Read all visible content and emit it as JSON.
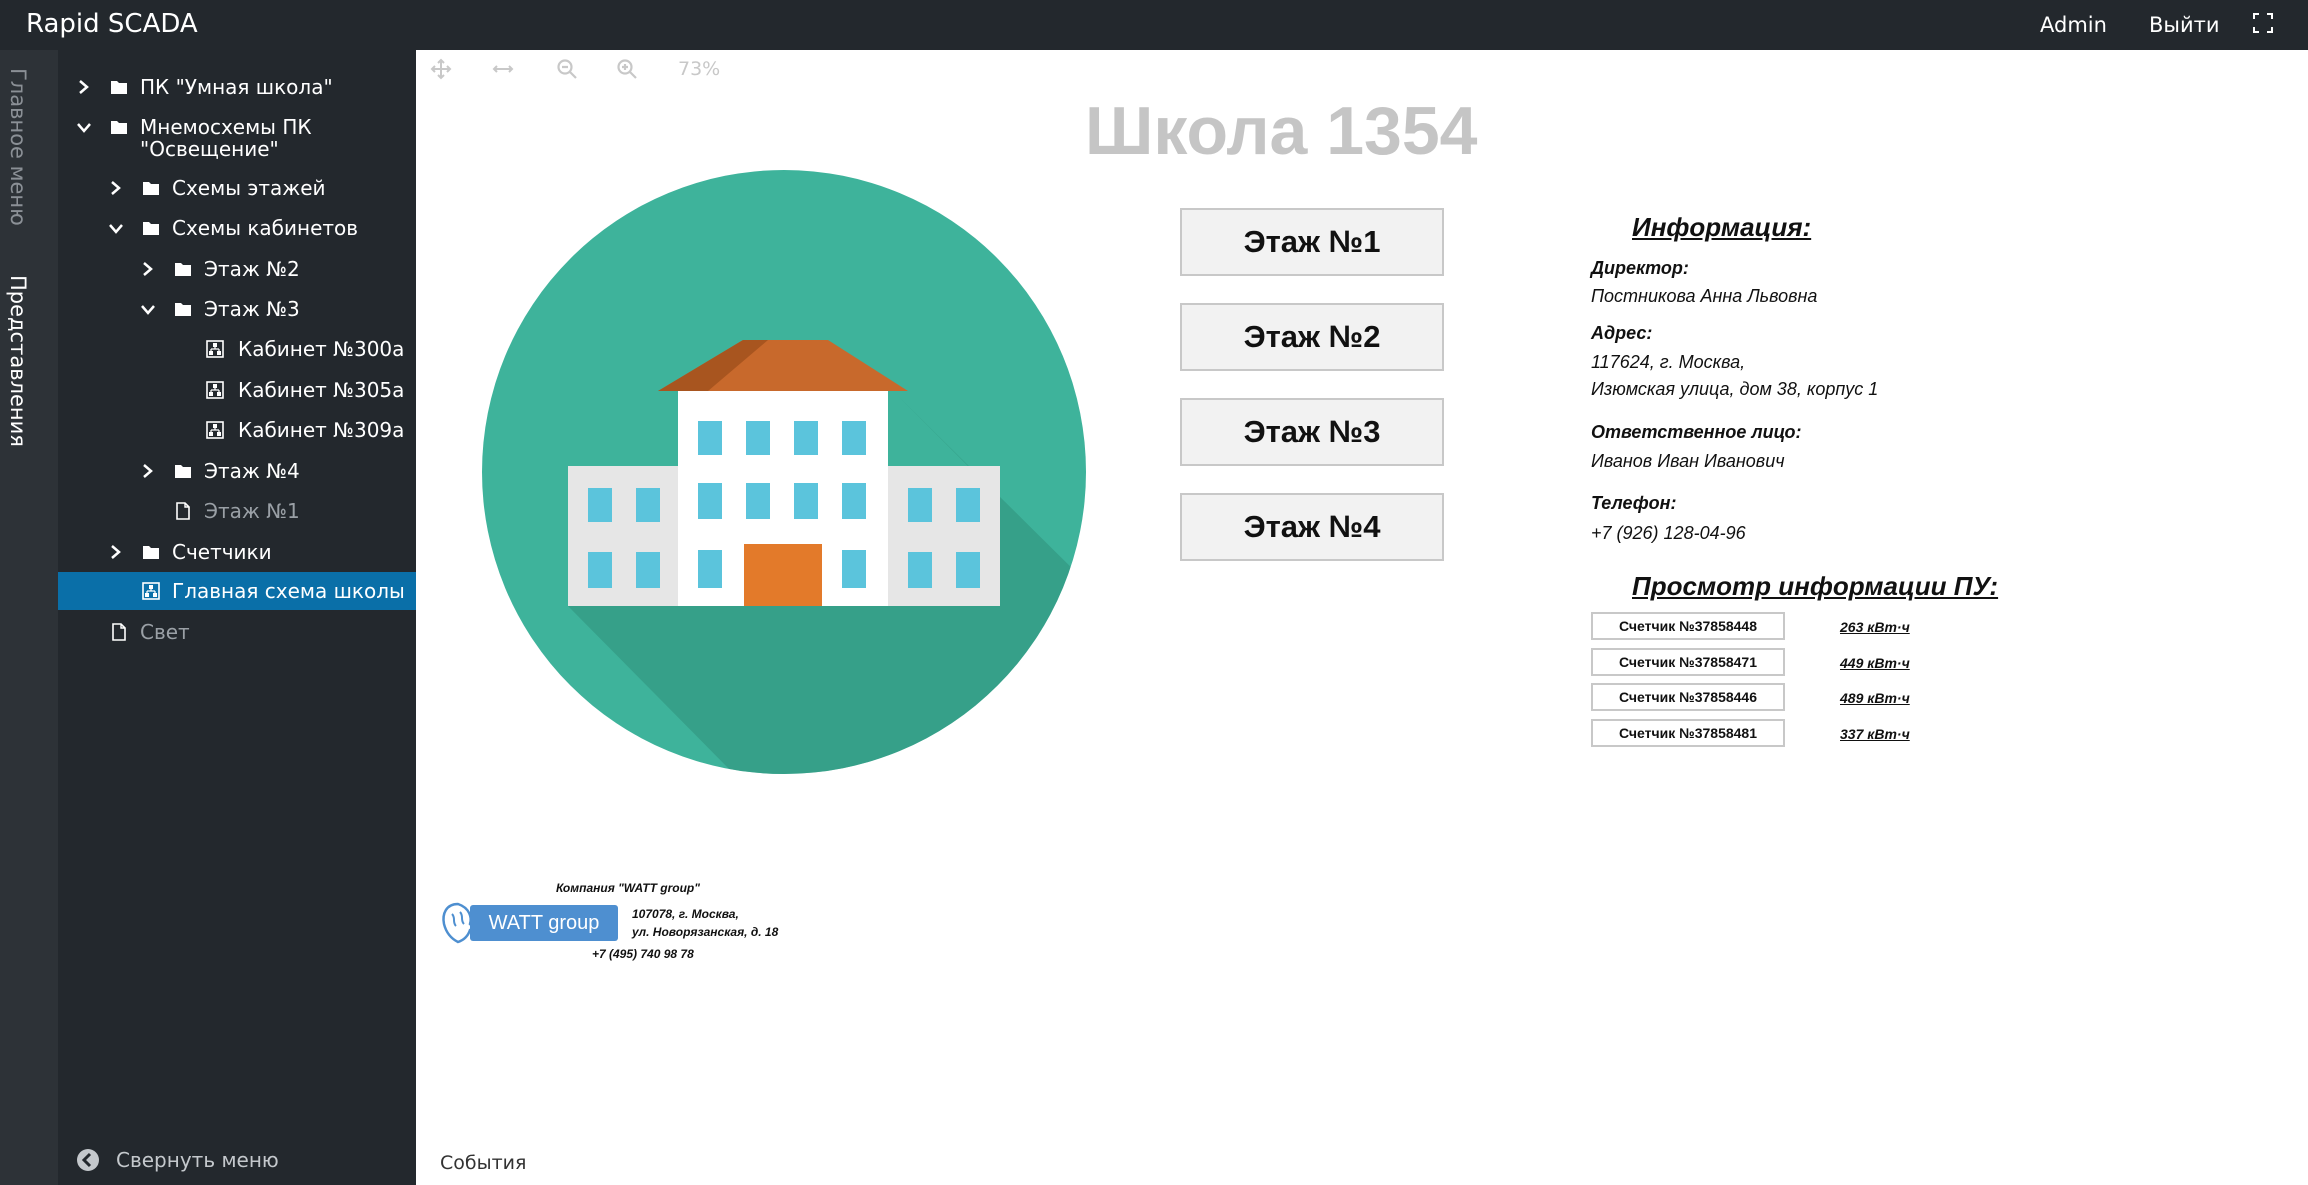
{
  "header": {
    "app_title": "Rapid SCADA",
    "user": "Admin",
    "logout": "Выйти"
  },
  "vtabs": {
    "main_menu": "Главное меню",
    "views": "Представления"
  },
  "tree": [
    {
      "label": "ПК \"Умная школа\"",
      "icon": "folder-icon",
      "chevron": "chevron-right-icon"
    },
    {
      "label1": "Мнемосхемы ПК",
      "label2": "\"Освещение\"",
      "icon": "folder-icon",
      "chevron": "chevron-down-icon"
    },
    {
      "label": "Схемы этажей",
      "icon": "folder-icon",
      "chevron": "chevron-right-icon"
    },
    {
      "label": "Схемы кабинетов",
      "icon": "folder-icon",
      "chevron": "chevron-down-icon"
    },
    {
      "label": "Этаж №2",
      "icon": "folder-icon",
      "chevron": "chevron-right-icon"
    },
    {
      "label": "Этаж №3",
      "icon": "folder-icon",
      "chevron": "chevron-down-icon"
    },
    {
      "label": "Кабинет №300а",
      "icon": "scheme-icon"
    },
    {
      "label": "Кабинет №305а",
      "icon": "scheme-icon"
    },
    {
      "label": "Кабинет №309а",
      "icon": "scheme-icon"
    },
    {
      "label": "Этаж №4",
      "icon": "folder-icon",
      "chevron": "chevron-right-icon"
    },
    {
      "label": "Этаж №1",
      "icon": "file-icon"
    },
    {
      "label": "Счетчики",
      "icon": "folder-icon",
      "chevron": "chevron-right-icon"
    },
    {
      "label": "Главная схема школы",
      "icon": "scheme-icon",
      "selected": true
    },
    {
      "label": "Свет",
      "icon": "file-icon"
    }
  ],
  "sidebar_bottom": {
    "collapse_label": "Свернуть меню"
  },
  "toolbar": {
    "zoom": "73%"
  },
  "schema": {
    "title": "Школа 1354",
    "floors": [
      "Этаж №1",
      "Этаж №2",
      "Этаж №3",
      "Этаж №4"
    ],
    "info": {
      "heading": "Информация:",
      "director_label": "Директор:",
      "director": "Постникова Анна Львовна",
      "address_label": "Адрес:",
      "address_line1": "117624, г. Москва,",
      "address_line2": "Изюмская улица, дом 38, корпус 1",
      "responsible_label": "Ответственное лицо:",
      "responsible": "Иванов Иван Иванович",
      "phone_label": "Телефон:",
      "phone": "+7 (926) 128-04-96"
    },
    "meters_heading": "Просмотр информации ПУ:",
    "meters": [
      {
        "name": "Счетчик №37858448",
        "value": "263 кВт·ч"
      },
      {
        "name": "Счетчик №37858471",
        "value": "449 кВт·ч"
      },
      {
        "name": "Счетчик №37858446",
        "value": "489 кВт·ч"
      },
      {
        "name": "Счетчик №37858481",
        "value": "337 кВт·ч"
      }
    ],
    "company": {
      "name": "Компания \"WATT group\"",
      "logo_text": "WATT group",
      "address_line1": "107078, г. Москва,",
      "address_line2": "ул. Новорязанская, д. 18",
      "phone": "+7 (495) 740 98 78"
    }
  },
  "footer": {
    "events": "События"
  },
  "colors": {
    "topbar": "#23282d",
    "sidebar": "#23282d",
    "selected": "#0a6fa8",
    "circle": "#3eb39b",
    "roof": "#c8692c",
    "window": "#5bc4dc",
    "door": "#e37a2a"
  }
}
